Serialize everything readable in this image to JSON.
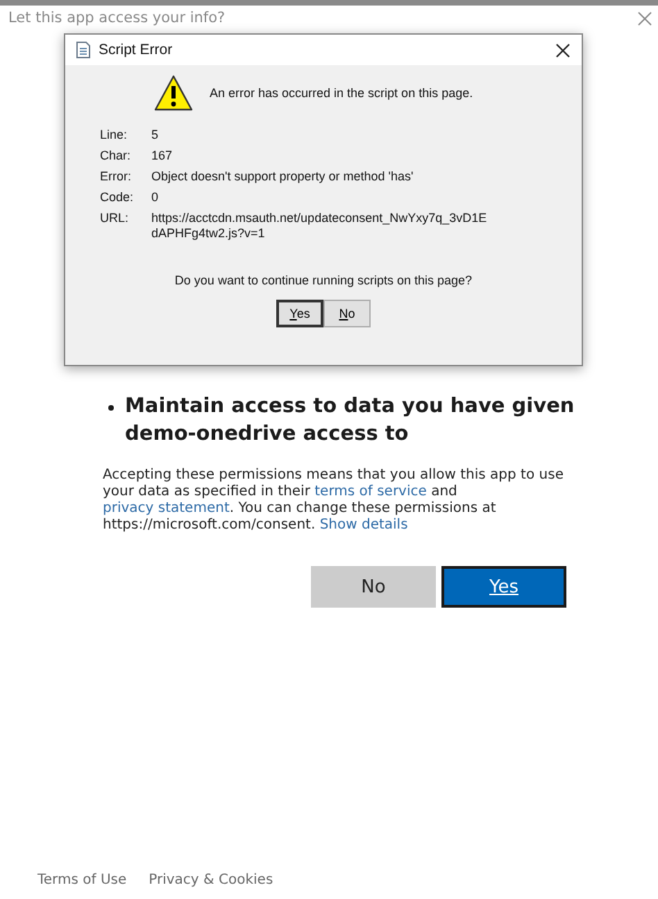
{
  "page": {
    "title": "Let this app access your info?",
    "permission": "Maintain access to data you have given demo-onedrive access to",
    "consent": {
      "before": "Accepting these permissions means that you allow this app to use your data as specified in their ",
      "terms_link": "terms of service",
      "middle": " and ",
      "privacy_link": "privacy statement",
      "after": ". You can change these permissions at https://microsoft.com/consent. ",
      "details_link": "Show details"
    },
    "buttons": [
      {
        "label": "No",
        "kind": "secondary"
      },
      {
        "label": "Yes",
        "kind": "primary"
      }
    ],
    "footer": [
      "Terms of Use",
      "Privacy & Cookies"
    ]
  },
  "dialog": {
    "title": "Script Error",
    "message": "An error has occurred in the script on this page.",
    "fields": [
      {
        "label": "Line:",
        "value": "5"
      },
      {
        "label": "Char:",
        "value": "167"
      },
      {
        "label": "Error:",
        "value": "Object doesn't support property or method 'has'"
      },
      {
        "label": "Code:",
        "value": "0"
      },
      {
        "label": "URL:",
        "value": "https://acctcdn.msauth.net/updateconsent_NwYxy7q_3vD1E dAPHFg4tw2.js?v=1"
      }
    ],
    "question": "Do you want to continue running scripts on this page?",
    "buttons": [
      {
        "label": "Yes",
        "selected": true
      },
      {
        "label": "No",
        "selected": false
      }
    ]
  }
}
